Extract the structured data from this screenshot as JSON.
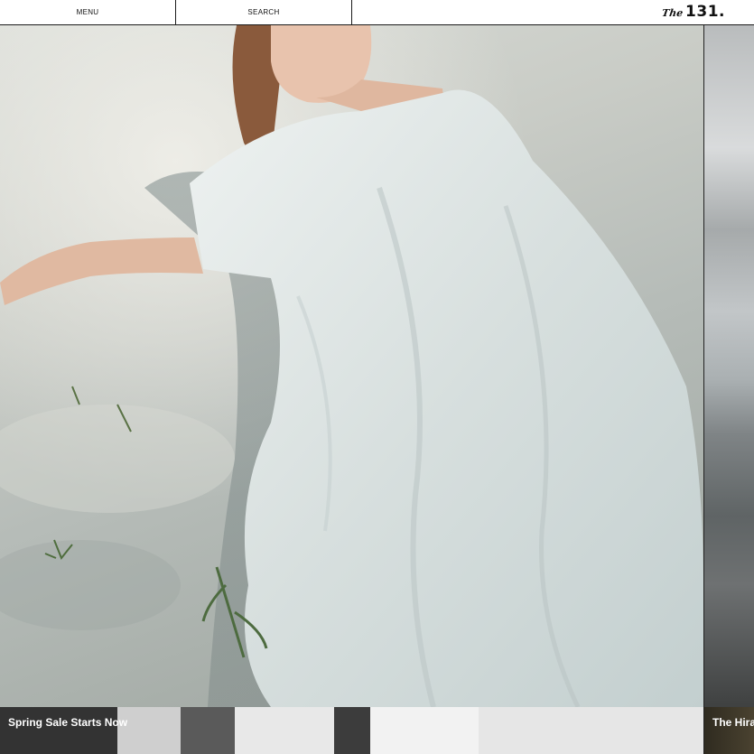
{
  "header": {
    "menu_label": "MENU",
    "search_label": "SEARCH",
    "logo_the": "The",
    "logo_number": "131."
  },
  "cards": [
    {
      "title": "Spring Sale Starts Now"
    },
    {
      "title": "The Hira"
    }
  ]
}
